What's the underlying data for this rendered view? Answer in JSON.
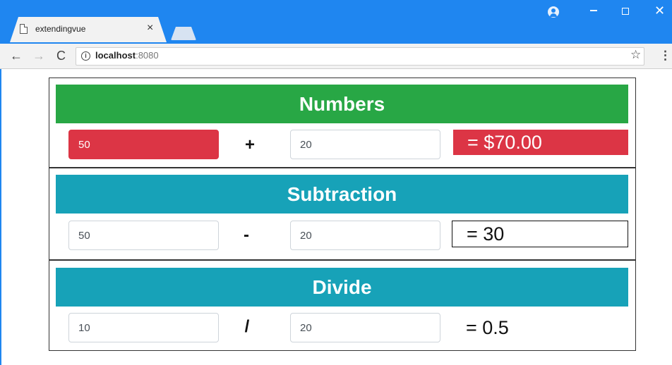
{
  "browser": {
    "tab_title": "extendingvue",
    "tab_close": "×",
    "url_host": "localhost",
    "url_port": ":8080",
    "icons": [
      "document-icon",
      "close-icon",
      "profile-icon",
      "minimize-icon",
      "maximize-icon",
      "back-icon",
      "forward-icon",
      "reload-icon",
      "info-icon",
      "star-icon",
      "menu-icon"
    ],
    "glyphs": {
      "back": "←",
      "forward": "→",
      "reload": "C",
      "info": "i",
      "star": "☆",
      "menu": "⋮",
      "close": "✕"
    }
  },
  "sections": [
    {
      "title": "Numbers",
      "header_color": "#28a745",
      "first": "50",
      "operator": "+",
      "second": "20",
      "result": "= $70.00",
      "first_state": "invalid"
    },
    {
      "title": "Subtraction",
      "header_color": "#17a2b8",
      "first": "50",
      "operator": "-",
      "second": "20",
      "result": "= 30"
    },
    {
      "title": "Divide",
      "header_color": "#17a2b8",
      "first": "10",
      "operator": "/",
      "second": "20",
      "result": "= 0.5"
    }
  ],
  "colors": {
    "titlebar": "#1f86f0",
    "danger": "#dc3545",
    "success": "#28a745",
    "info": "#17a2b8"
  }
}
